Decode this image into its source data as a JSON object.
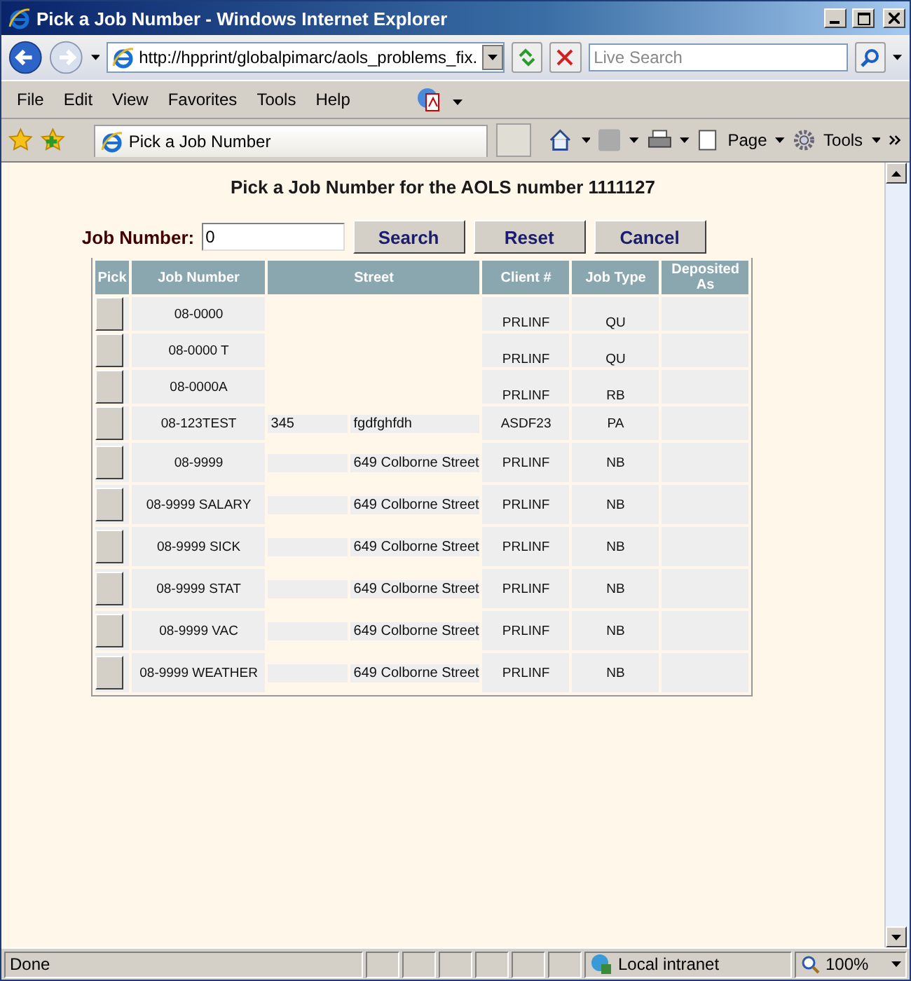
{
  "window": {
    "title": "Pick a Job Number - Windows Internet Explorer"
  },
  "address_bar": {
    "value": "http://hpprint/globalpimarc/aols_problems_fix."
  },
  "search": {
    "placeholder": "Live Search"
  },
  "menu": [
    "File",
    "Edit",
    "View",
    "Favorites",
    "Tools",
    "Help"
  ],
  "tab": {
    "label": "Pick a Job Number"
  },
  "command_bar": [
    "Page",
    "Tools"
  ],
  "page": {
    "heading": "Pick a Job Number for the AOLS number 1111127",
    "field_label": "Job Number:",
    "field_value": "0",
    "buttons": [
      "Search",
      "Reset",
      "Cancel"
    ],
    "columns": [
      "Pick",
      "Job Number",
      "Street",
      "Client #",
      "Job Type",
      "Deposited As"
    ],
    "rows": [
      {
        "job": "08-0000",
        "client": "PRLINF",
        "type": "QU"
      },
      {
        "job": "08-0000 T",
        "client": "PRLINF",
        "type": "QU"
      },
      {
        "job": "08-0000A",
        "client": "PRLINF",
        "type": "RB"
      },
      {
        "job": "08-123TEST",
        "street_number": "345",
        "street_name": "fgdfghfdh",
        "client": "ASDF23",
        "type": "PA"
      },
      {
        "job": "08-9999",
        "street_name": "649 Colborne Street",
        "client": "PRLINF",
        "type": "NB"
      },
      {
        "job": "08-9999 SALARY",
        "street_name": "649 Colborne Street",
        "client": "PRLINF",
        "type": "NB"
      },
      {
        "job": "08-9999 SICK",
        "street_name": "649 Colborne Street",
        "client": "PRLINF",
        "type": "NB"
      },
      {
        "job": "08-9999 STAT",
        "street_name": "649 Colborne Street",
        "client": "PRLINF",
        "type": "NB"
      },
      {
        "job": "08-9999 VAC",
        "street_name": "649 Colborne Street",
        "client": "PRLINF",
        "type": "NB"
      },
      {
        "job": "08-9999 WEATHER",
        "street_name": "649 Colborne Street",
        "client": "PRLINF",
        "type": "NB"
      }
    ]
  },
  "status_bar": {
    "text": "Done",
    "zone": "Local intranet",
    "zoom": "100%"
  }
}
